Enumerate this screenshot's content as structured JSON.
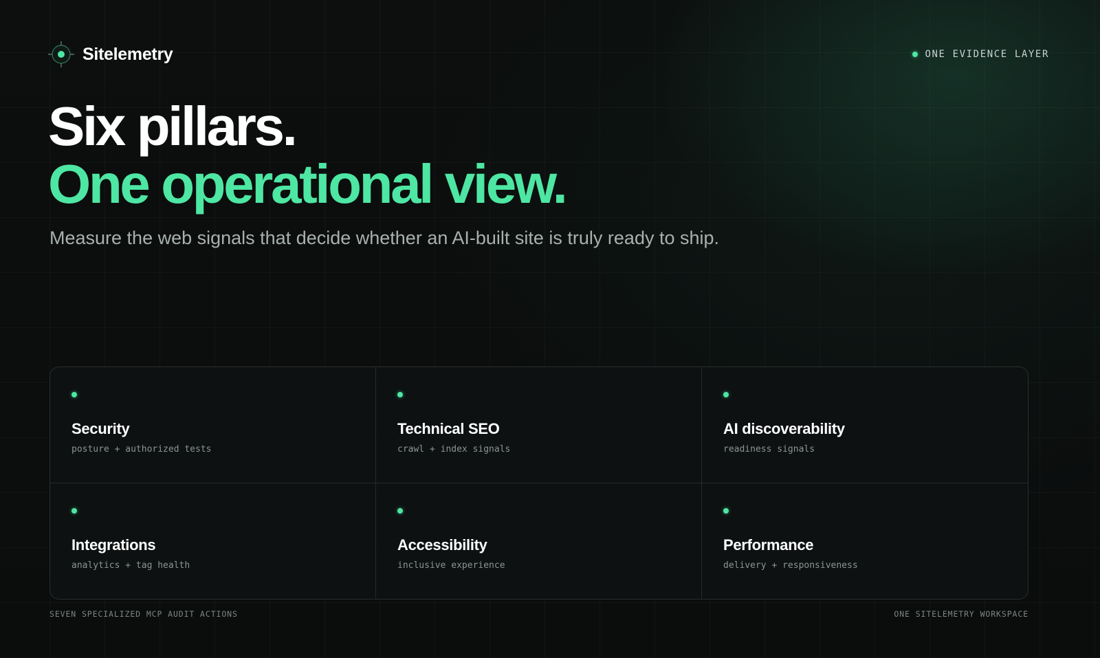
{
  "brand": {
    "name": "Sitelemetry",
    "logo_icon": "crosshair-target-icon",
    "accent_color": "#4ee6a3"
  },
  "badge": {
    "label": "ONE EVIDENCE LAYER",
    "icon": "status-dot-icon"
  },
  "hero": {
    "headline_line1": "Six pillars.",
    "headline_line2": "One operational view.",
    "subtitle": "Measure the web signals that decide whether an AI-built site is truly ready to ship."
  },
  "pillars": [
    {
      "title": "Security",
      "description": "posture + authorized tests"
    },
    {
      "title": "Technical SEO",
      "description": "crawl + index signals"
    },
    {
      "title": "AI discoverability",
      "description": "readiness signals"
    },
    {
      "title": "Integrations",
      "description": "analytics + tag health"
    },
    {
      "title": "Accessibility",
      "description": "inclusive experience"
    },
    {
      "title": "Performance",
      "description": "delivery + responsiveness"
    }
  ],
  "footer": {
    "left": "SEVEN SPECIALIZED MCP AUDIT ACTIONS",
    "right": "ONE SITELEMETRY WORKSPACE"
  }
}
